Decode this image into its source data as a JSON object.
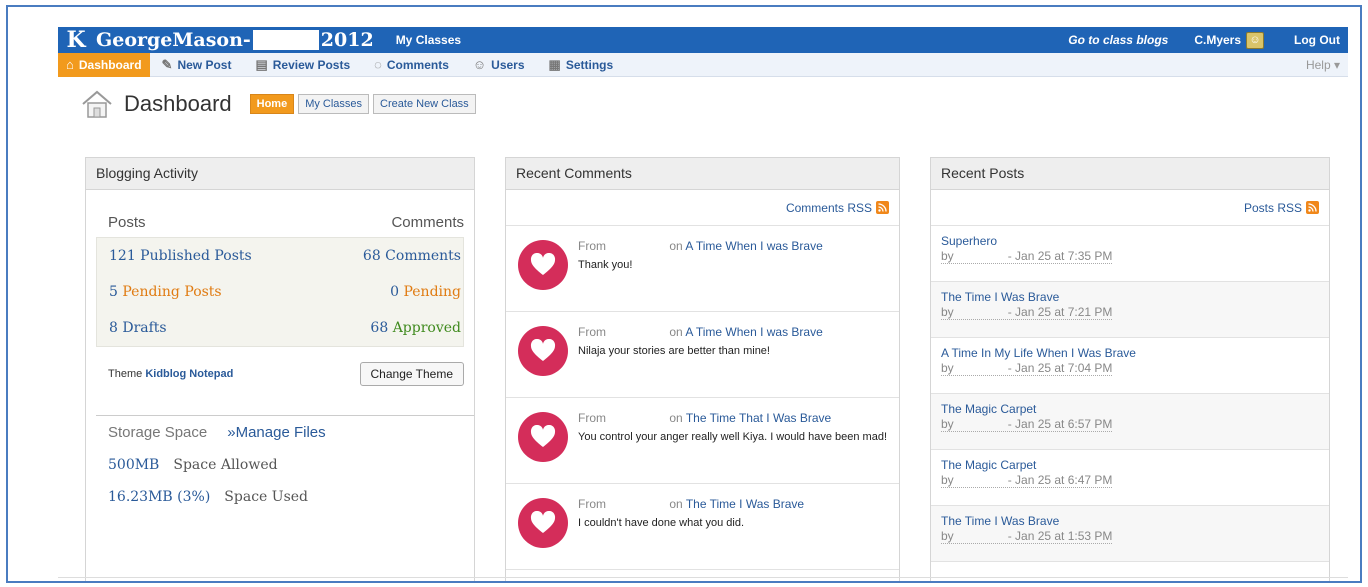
{
  "topbar": {
    "logo": "K",
    "site_prefix": "GeorgeMason-",
    "site_suffix": "2012",
    "my_classes": "My Classes",
    "go_to_blogs": "Go to class blogs",
    "user": "C.Myers",
    "logout": "Log Out"
  },
  "nav": {
    "items": [
      {
        "label": "Dashboard",
        "icon": "home-icon"
      },
      {
        "label": "New Post",
        "icon": "pin-icon"
      },
      {
        "label": "Review Posts",
        "icon": "document-icon"
      },
      {
        "label": "Comments",
        "icon": "speech-bubble-icon"
      },
      {
        "label": "Users",
        "icon": "users-icon"
      },
      {
        "label": "Settings",
        "icon": "settings-icon"
      }
    ],
    "help": "Help ▾"
  },
  "header": {
    "title": "Dashboard",
    "buttons": [
      "Home",
      "My Classes",
      "Create New Class"
    ]
  },
  "activity": {
    "title": "Blogging Activity",
    "col_posts": "Posts",
    "col_comments": "Comments",
    "rows": [
      {
        "left": "121 Published Posts",
        "right": "68 Comments"
      },
      {
        "left_num": "5",
        "left_text": "Pending Posts",
        "right_num": "0",
        "right_text": "Pending"
      },
      {
        "left": "8 Drafts",
        "right_num": "68",
        "right_text": "Approved"
      }
    ],
    "theme_label": "Theme",
    "theme_name": "Kidblog Notepad",
    "change_theme": "Change Theme",
    "storage_label": "Storage Space",
    "manage_files": "»Manage Files",
    "space_allowed_value": "500MB",
    "space_allowed_label": "Space Allowed",
    "space_used_value": "16.23MB (3%)",
    "space_used_label": "Space Used"
  },
  "comments": {
    "title": "Recent Comments",
    "rss": "Comments RSS",
    "items": [
      {
        "from": "From",
        "on": "on",
        "post": "A Time When I was Brave",
        "text": "Thank you!"
      },
      {
        "from": "From",
        "on": "on",
        "post": "A Time When I was Brave",
        "text": "Nilaja your stories are better than mine!"
      },
      {
        "from": "From",
        "on": "on",
        "post": "The Time That I Was Brave",
        "text": "You control your anger really well Kiya. I would have been mad!"
      },
      {
        "from": "From",
        "on": "on",
        "post": "The Time I Was Brave",
        "text": "I couldn't have done what you did."
      }
    ]
  },
  "posts": {
    "title": "Recent Posts",
    "rss": "Posts RSS",
    "items": [
      {
        "title": "Superhero",
        "by": "by",
        "date": "- Jan 25 at 7:35 PM"
      },
      {
        "title": "The Time I Was Brave",
        "by": "by",
        "date": "- Jan 25 at 7:21 PM"
      },
      {
        "title": "A Time In My Life When I Was Brave",
        "by": "by",
        "date": "- Jan 25 at 7:04 PM"
      },
      {
        "title": "The Magic Carpet",
        "by": "by",
        "date": "- Jan 25 at 6:57 PM"
      },
      {
        "title": "The Magic Carpet",
        "by": "by",
        "date": "- Jan 25 at 6:47 PM"
      },
      {
        "title": "The Time I Was Brave",
        "by": "by",
        "date": "- Jan 25 at 1:53 PM"
      }
    ]
  },
  "colors": {
    "topbar": "#1f64b6",
    "accent_orange": "#f29a1d",
    "link_blue": "#2a5a99",
    "heart_red": "#d42d5a",
    "approved_green": "#3f8a1d"
  }
}
